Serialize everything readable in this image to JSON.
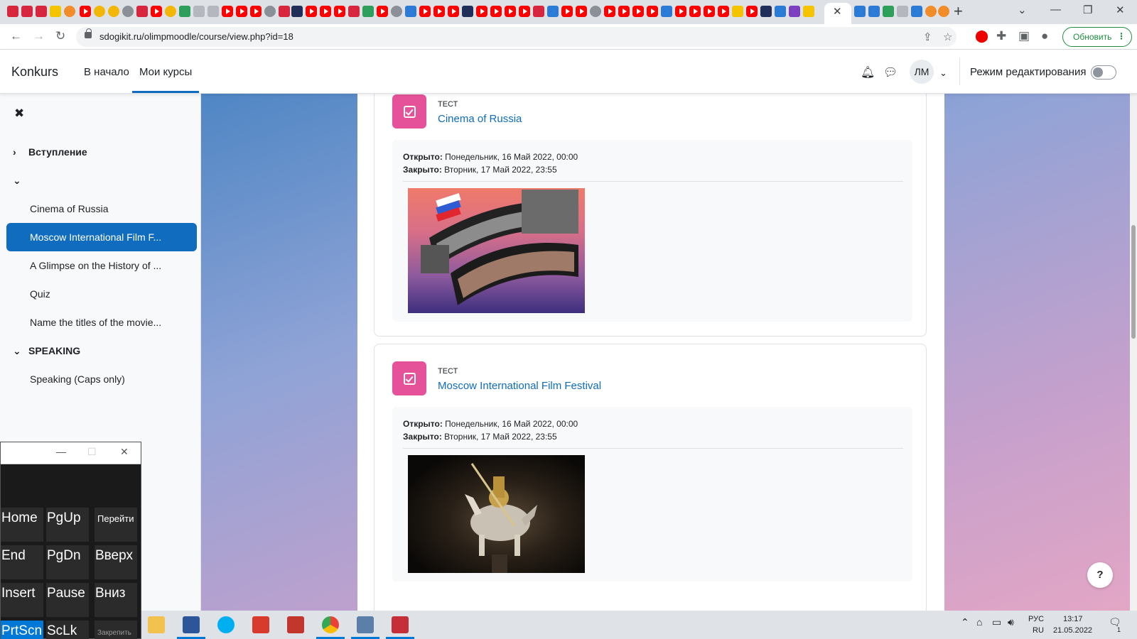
{
  "browser": {
    "active_tab_close": "✕",
    "new_tab": "+",
    "url": "sdogikit.ru/olimpmoodle/course/view.php?id=18",
    "update_label": "Обновить"
  },
  "site": {
    "brand": "Konkurs",
    "nav": [
      "В начало",
      "Мои курсы"
    ],
    "avatar_initials": "ЛМ",
    "edit_mode_label": "Режим редактирования"
  },
  "course_index": {
    "close_glyph": "✖",
    "sections": [
      {
        "title": "Вступление",
        "expanded": false
      },
      {
        "title": "",
        "expanded": true
      },
      {
        "title": "SPEAKING",
        "expanded": true
      }
    ],
    "items": [
      "Cinema of Russia",
      "Moscow International Film F...",
      "A Glimpse on the History of ...",
      "Quiz",
      "Name the titles of the movie...",
      "Speaking (Caps only)"
    ],
    "active_item": "Moscow International Film F..."
  },
  "activities": [
    {
      "type": "ТЕСТ",
      "title": "Cinema of Russia",
      "opened_label": "Открыто:",
      "opened_value": " Понедельник, 16 Май 2022, 00:00",
      "closed_label": "Закрыто:",
      "closed_value": " Вторник, 17 Май 2022, 23:55"
    },
    {
      "type": "ТЕСТ",
      "title": "Moscow International Film Festival",
      "opened_label": "Открыто:",
      "opened_value": " Понедельник, 16 Май 2022, 00:00",
      "closed_label": "Закрыто:",
      "closed_value": " Вторник, 17 Май 2022, 23:55"
    }
  ],
  "osk": {
    "keys": [
      [
        "Home",
        "PgUp",
        "Перейти"
      ],
      [
        "End",
        "PgDn",
        "Вверх"
      ],
      [
        "Insert",
        "Pause",
        "Вниз"
      ],
      [
        "PrtScn",
        "ScLk",
        "Закрепить"
      ]
    ]
  },
  "tray": {
    "lang_top": "РУС",
    "lang_bottom": "RU",
    "time": "13:17",
    "date": "21.05.2022",
    "notif_count": "1"
  },
  "help_label": "?",
  "colors": {
    "accent": "#0f6cbf",
    "quiz_icon": "#e5529a",
    "update_green": "#1e8e3e"
  }
}
